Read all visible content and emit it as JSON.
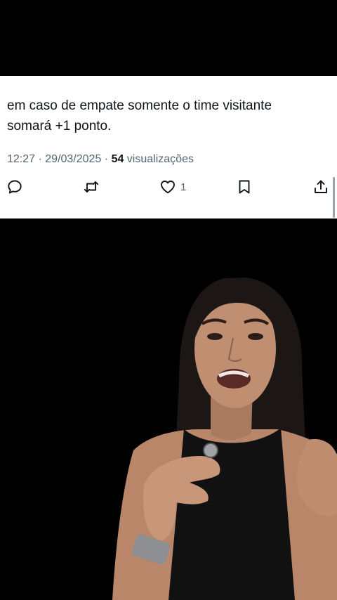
{
  "tweet": {
    "text_line1": "em caso de empate somente o time visitante",
    "text_line2": "somará +1 ponto.",
    "time": "12:27",
    "sep1": " · ",
    "date": "29/03/2025",
    "sep2": " · ",
    "views_count": "54",
    "views_label": " visualizações"
  },
  "actions": {
    "reply_icon": "reply-icon",
    "retweet_icon": "retweet-icon",
    "like_icon": "heart-icon",
    "like_count": "1",
    "bookmark_icon": "bookmark-icon",
    "share_icon": "share-icon"
  },
  "colors": {
    "text": "#0f1419",
    "secondary": "#536471",
    "background": "#ffffff",
    "video_bg": "#000000"
  }
}
